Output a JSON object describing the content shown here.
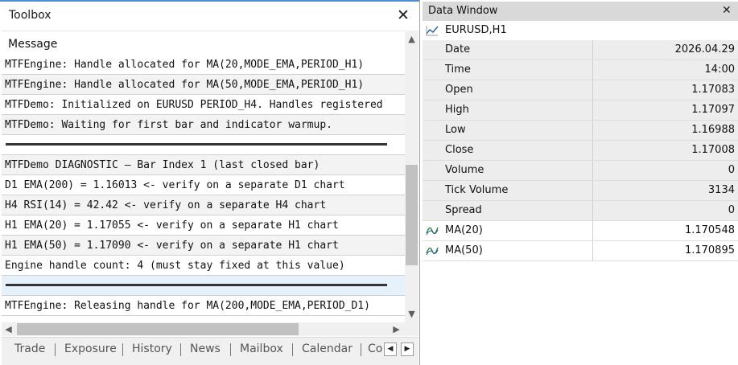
{
  "toolbox": {
    "title": "Toolbox",
    "close_glyph": "✕",
    "column_header": "Message",
    "messages": [
      "MTFEngine: Handle allocated for MA(20,MODE_EMA,PERIOD_H1)",
      "MTFEngine: Handle allocated for MA(50,MODE_EMA,PERIOD_H1)",
      "MTFDemo: Initialized on EURUSD PERIOD_H4. Handles registered",
      "MTFDemo: Waiting for first bar and indicator warmup.",
      "",
      "MTFDemo DIAGNOSTIC — Bar Index 1 (last closed bar)",
      "D1 EMA(200)  = 1.16013  <- verify on a separate D1 chart",
      "H4 RSI(14)   = 42.42  <- verify on a separate H4 chart",
      "H1 EMA(20)  = 1.17055  <- verify on a separate H1 chart",
      "H1 EMA(50)  = 1.17090  <- verify on a separate H1 chart",
      "Engine handle count: 4 (must stay fixed at this value)",
      "",
      "MTFEngine: Releasing handle for MA(200,MODE_EMA,PERIOD_D1)"
    ],
    "scroll_up": "▲",
    "scroll_down": "▼",
    "scroll_left": "◀",
    "scroll_right": "▶",
    "tabs": [
      "Trade",
      "Exposure",
      "History",
      "News",
      "Mailbox",
      "Calendar",
      "Company"
    ],
    "tab_nav_left": "◀",
    "tab_nav_right": "▶"
  },
  "data_window": {
    "title": "Data Window",
    "close_glyph": "✕",
    "symbol": "EURUSD,H1",
    "rows": [
      {
        "label": "Date",
        "value": "2026.04.29"
      },
      {
        "label": "Time",
        "value": "14:00"
      },
      {
        "label": "Open",
        "value": "1.17083"
      },
      {
        "label": "High",
        "value": "1.17097"
      },
      {
        "label": "Low",
        "value": "1.16988"
      },
      {
        "label": "Close",
        "value": "1.17008"
      },
      {
        "label": "Volume",
        "value": "0"
      },
      {
        "label": "Tick Volume",
        "value": "3134"
      },
      {
        "label": "Spread",
        "value": "0"
      },
      {
        "label": "MA(20)",
        "value": "1.170548"
      },
      {
        "label": "MA(50)",
        "value": "1.170895"
      }
    ]
  },
  "colors": {
    "accent_line": "#4a8fd8",
    "selected_row": "#e5f1fb",
    "indicator_icon": "#2e7d32",
    "chart_icon": "#1f5fa8"
  }
}
